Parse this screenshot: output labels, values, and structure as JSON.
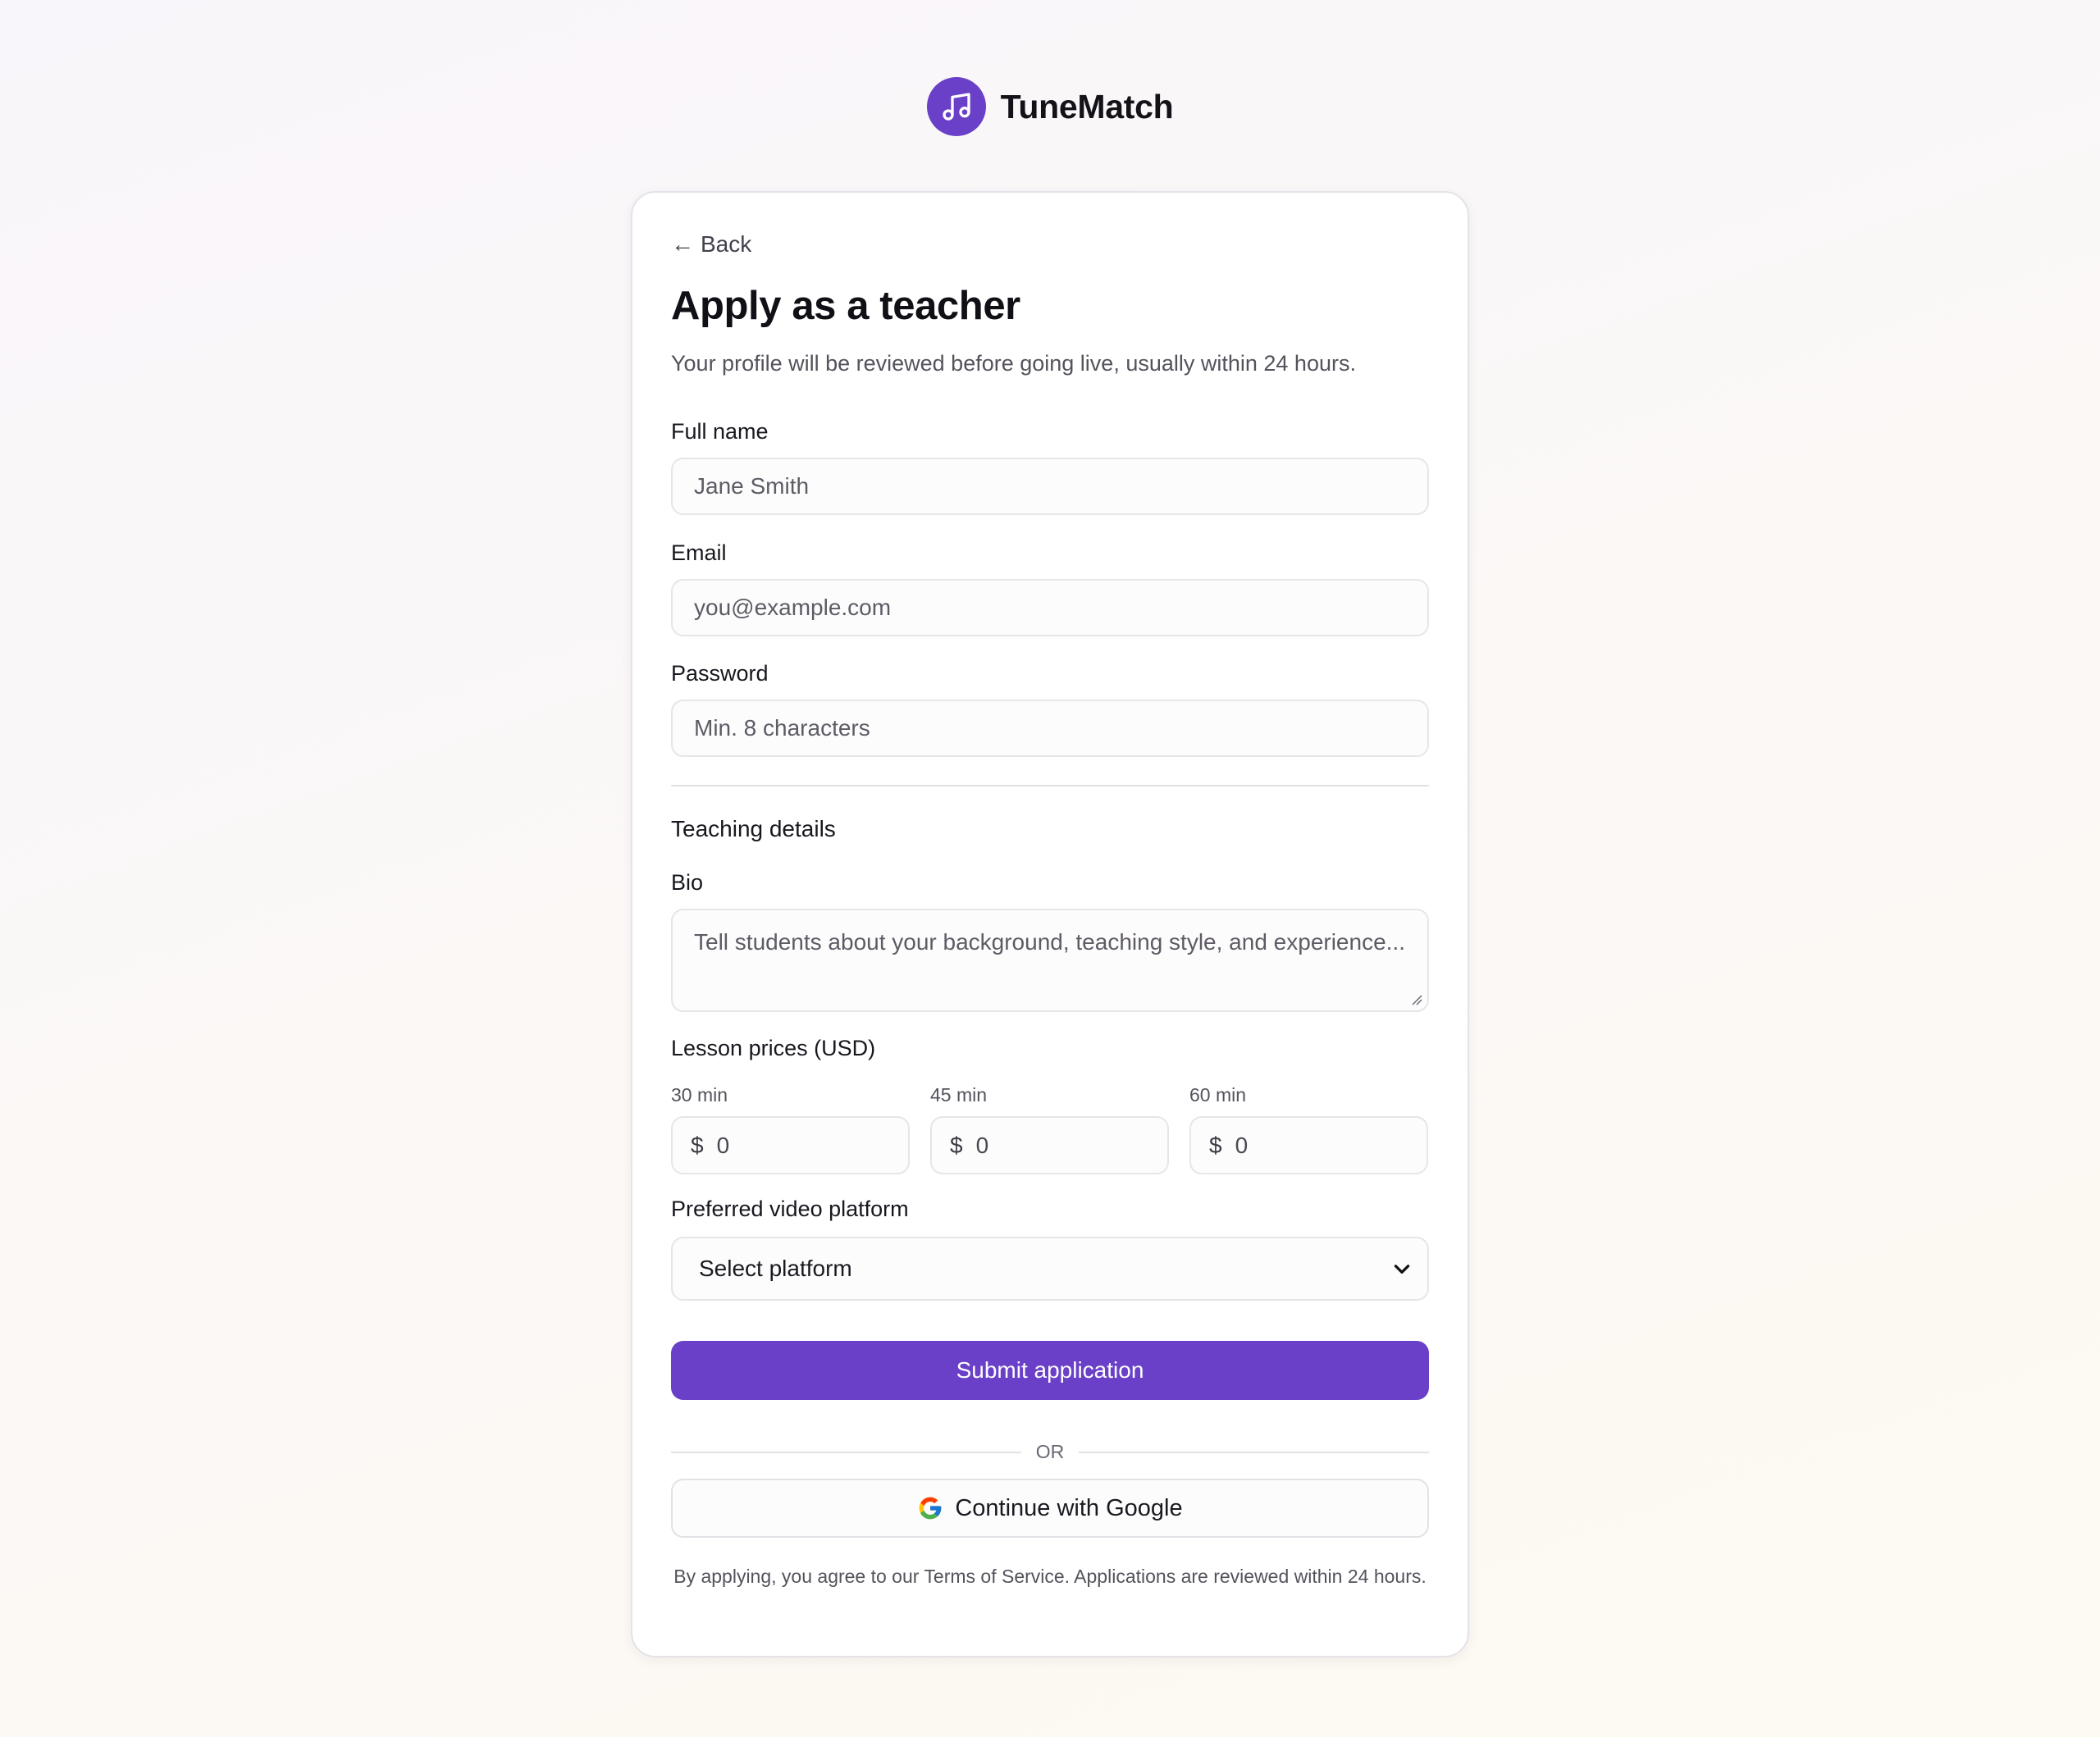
{
  "brand": {
    "name": "TuneMatch",
    "icon": "music-note-icon",
    "accent_color": "#6a40c8"
  },
  "nav": {
    "back_arrow": "←",
    "back_label": "Back"
  },
  "header": {
    "title": "Apply as a teacher",
    "subtitle": "Your profile will be reviewed before going live, usually within 24 hours."
  },
  "form": {
    "full_name": {
      "label": "Full name",
      "placeholder": "Jane Smith"
    },
    "email": {
      "label": "Email",
      "placeholder": "you@example.com"
    },
    "password": {
      "label": "Password",
      "placeholder": "Min. 8 characters"
    },
    "teaching_details_title": "Teaching details",
    "bio": {
      "label": "Bio",
      "placeholder": "Tell students about your background, teaching style, and experience..."
    },
    "lesson_prices": {
      "label": "Lesson prices (USD)",
      "currency": "$",
      "items": [
        {
          "duration": "30 min",
          "value": "0"
        },
        {
          "duration": "45 min",
          "value": "0"
        },
        {
          "duration": "60 min",
          "value": "0"
        }
      ]
    },
    "platform": {
      "label": "Preferred video platform",
      "selected": "Select platform"
    },
    "submit_label": "Submit application",
    "or_label": "OR",
    "google_label": "Continue with Google",
    "terms": "By applying, you agree to our Terms of Service. Applications are reviewed within 24 hours."
  }
}
